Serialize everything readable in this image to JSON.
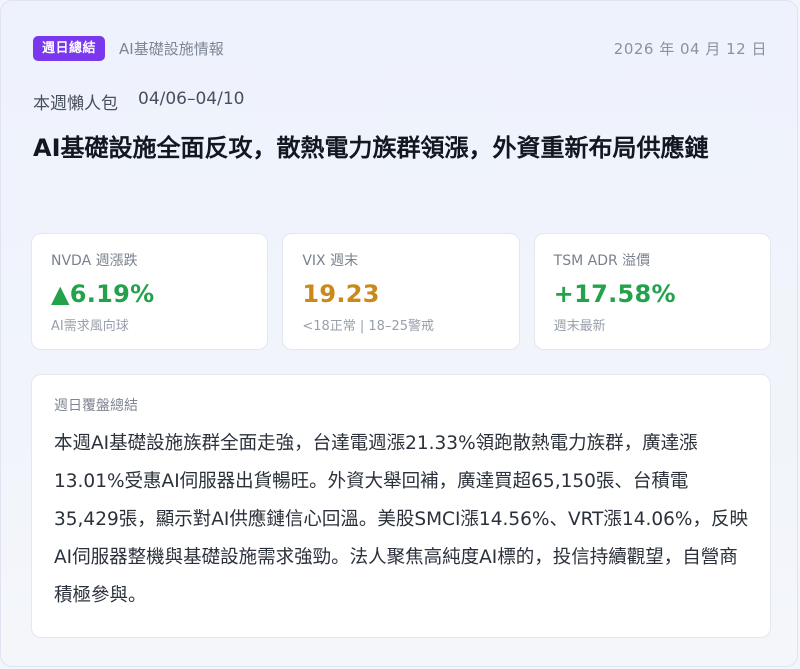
{
  "header": {
    "badge": "週日總結",
    "category": "AI基礎設施情報",
    "date": "2026 年 04 月 12 日"
  },
  "subline": {
    "label": "本週懶人包",
    "range": "04/06–04/10"
  },
  "headline": "AI基礎設施全面反攻，散熱電力族群領漲，外資重新布局供應鏈",
  "metrics": [
    {
      "label": "NVDA 週漲跌",
      "value": "▲6.19%",
      "sub": "AI需求風向球",
      "color": "#22a24a"
    },
    {
      "label": "VIX 週末",
      "value": "19.23",
      "sub": "<18正常 | 18–25警戒",
      "color": "#c98a1a"
    },
    {
      "label": "TSM ADR 溢價",
      "value": "+17.58%",
      "sub": "週末最新",
      "color": "#22a24a"
    }
  ],
  "summary": {
    "label": "週日覆盤總結",
    "text": "本週AI基礎設施族群全面走強，台達電週漲21.33%領跑散熱電力族群，廣達漲13.01%受惠AI伺服器出貨暢旺。外資大舉回補，廣達買超65,150張、台積電35,429張，顯示對AI供應鏈信心回溫。美股SMCI漲14.56%、VRT漲14.06%，反映AI伺服器整機與基礎設施需求強勁。法人聚焦高純度AI標的，投信持續觀望，自營商積極參與。"
  }
}
